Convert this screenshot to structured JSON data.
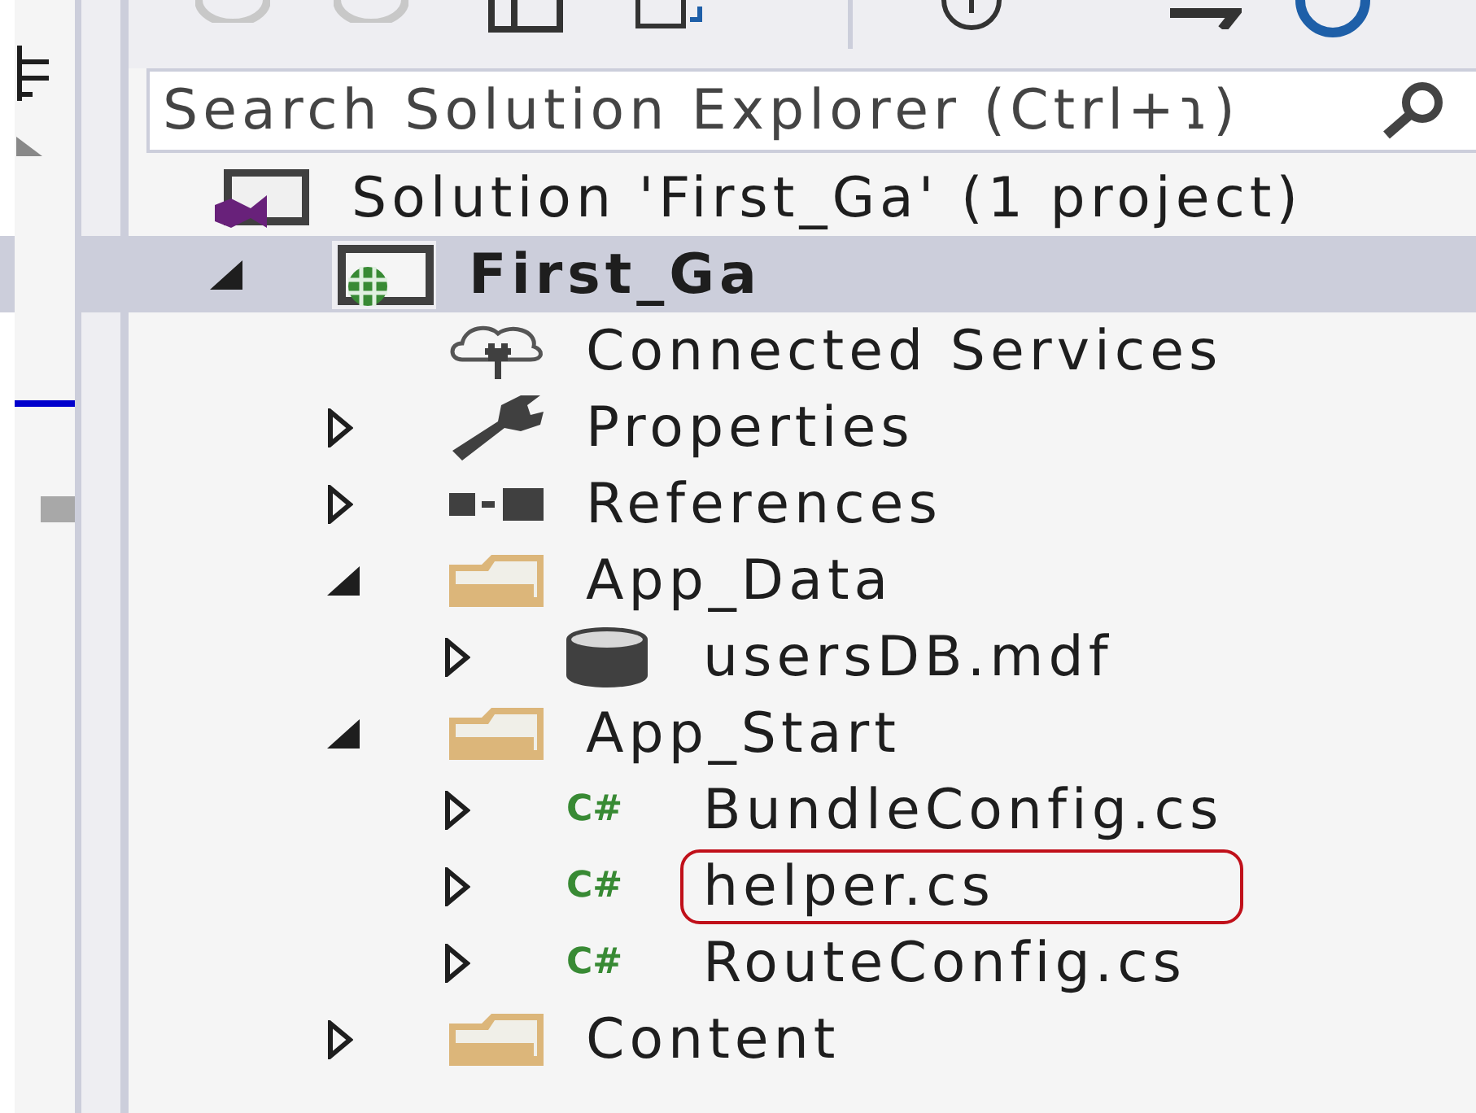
{
  "search": {
    "placeholder": "Search Solution Explorer (Ctrl+ɿ)"
  },
  "tree": [
    {
      "label": "Solution 'First_Ga' (1 project)",
      "kind": "solution",
      "selected": false,
      "annotated": false,
      "children": [
        {
          "label": "First_Ga",
          "kind": "web-project",
          "expanded": true,
          "bold": true,
          "selected": true,
          "annotated": false,
          "children": [
            {
              "label": "Connected Services",
              "kind": "cloud",
              "selected": false,
              "annotated": false
            },
            {
              "label": "Properties",
              "kind": "wrench",
              "expanded": false,
              "selected": false,
              "annotated": false
            },
            {
              "label": "References",
              "kind": "references",
              "expanded": false,
              "selected": false,
              "annotated": false
            },
            {
              "label": "App_Data",
              "kind": "folder",
              "expanded": true,
              "selected": false,
              "annotated": false,
              "children": [
                {
                  "label": "usersDB.mdf",
                  "kind": "database",
                  "expanded": false,
                  "selected": false,
                  "annotated": false
                }
              ]
            },
            {
              "label": "App_Start",
              "kind": "folder",
              "expanded": true,
              "selected": false,
              "annotated": false,
              "children": [
                {
                  "label": "BundleConfig.cs",
                  "kind": "csharp",
                  "glyph": "C#",
                  "expanded": false,
                  "selected": false,
                  "annotated": false
                },
                {
                  "label": "helper.cs",
                  "kind": "csharp",
                  "glyph": "C#",
                  "expanded": false,
                  "selected": false,
                  "annotated": true
                },
                {
                  "label": "RouteConfig.cs",
                  "kind": "csharp",
                  "glyph": "C#",
                  "expanded": false,
                  "selected": false,
                  "annotated": false
                }
              ]
            },
            {
              "label": "Content",
              "kind": "folder",
              "expanded": false,
              "selected": false,
              "annotated": false
            }
          ]
        }
      ]
    }
  ]
}
